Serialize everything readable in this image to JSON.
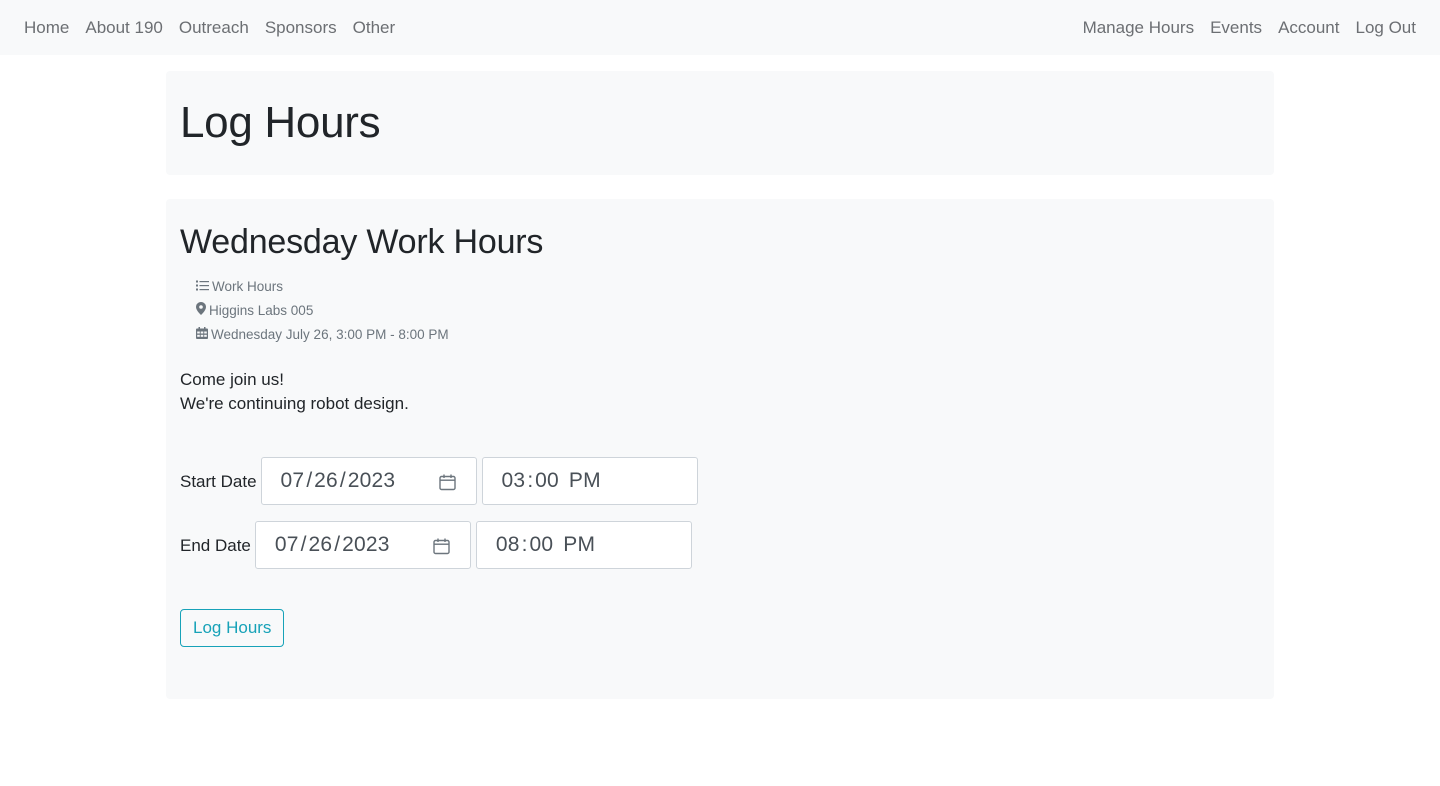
{
  "nav": {
    "left": [
      "Home",
      "About 190",
      "Outreach",
      "Sponsors",
      "Other"
    ],
    "right": [
      "Manage Hours",
      "Events",
      "Account",
      "Log Out"
    ]
  },
  "page_title": "Log Hours",
  "event": {
    "title": "Wednesday Work Hours",
    "category": "Work Hours",
    "location": "Higgins Labs 005",
    "datetime": "Wednesday July 26, 3:00 PM - 8:00 PM",
    "description_lines": [
      "Come join us!",
      "We're continuing robot design."
    ]
  },
  "form": {
    "start": {
      "label": "Start Date",
      "month": "07",
      "day": "26",
      "year": "2023",
      "hour": "03",
      "minute": "00",
      "ampm": "PM"
    },
    "end": {
      "label": "End Date",
      "month": "07",
      "day": "26",
      "year": "2023",
      "hour": "08",
      "minute": "00",
      "ampm": "PM"
    },
    "submit_label": "Log Hours"
  },
  "colors": {
    "navbar_bg": "#f8f9fa",
    "card_bg": "#f8f9fa",
    "accent": "#17a2b8"
  },
  "icons": [
    "list-icon",
    "map-marker-icon",
    "calendar-icon"
  ]
}
